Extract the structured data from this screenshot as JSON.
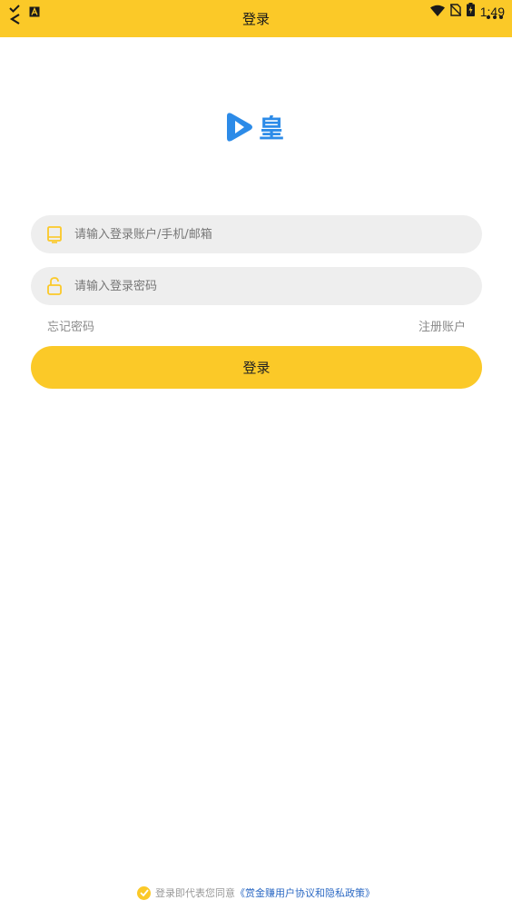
{
  "colors": {
    "accent": "#FBC928",
    "logo_blue": "#2C8BE8",
    "field_bg": "#EEEEEE",
    "link_blue": "#2d6ac4"
  },
  "status_bar": {
    "time": "1:49",
    "icons": [
      "notification-check-icon",
      "keyboard-a-icon",
      "wifi-icon",
      "no-sim-icon",
      "battery-charging-icon"
    ]
  },
  "header": {
    "title": "登录"
  },
  "logo": {
    "text": "皇",
    "icon": "play-circle-icon"
  },
  "form": {
    "account": {
      "placeholder": "请输入登录账户/手机/邮箱",
      "value": "",
      "icon": "id-card-icon"
    },
    "password": {
      "placeholder": "请输入登录密码",
      "value": "",
      "icon": "lock-open-icon"
    },
    "forgot_label": "忘记密码",
    "register_label": "注册账户",
    "submit_label": "登录"
  },
  "agreement": {
    "prefix": "登录即代表您同意",
    "policy_text": "《赏金赚用户协议和隐私政策》",
    "icon": "check-circle-icon"
  }
}
